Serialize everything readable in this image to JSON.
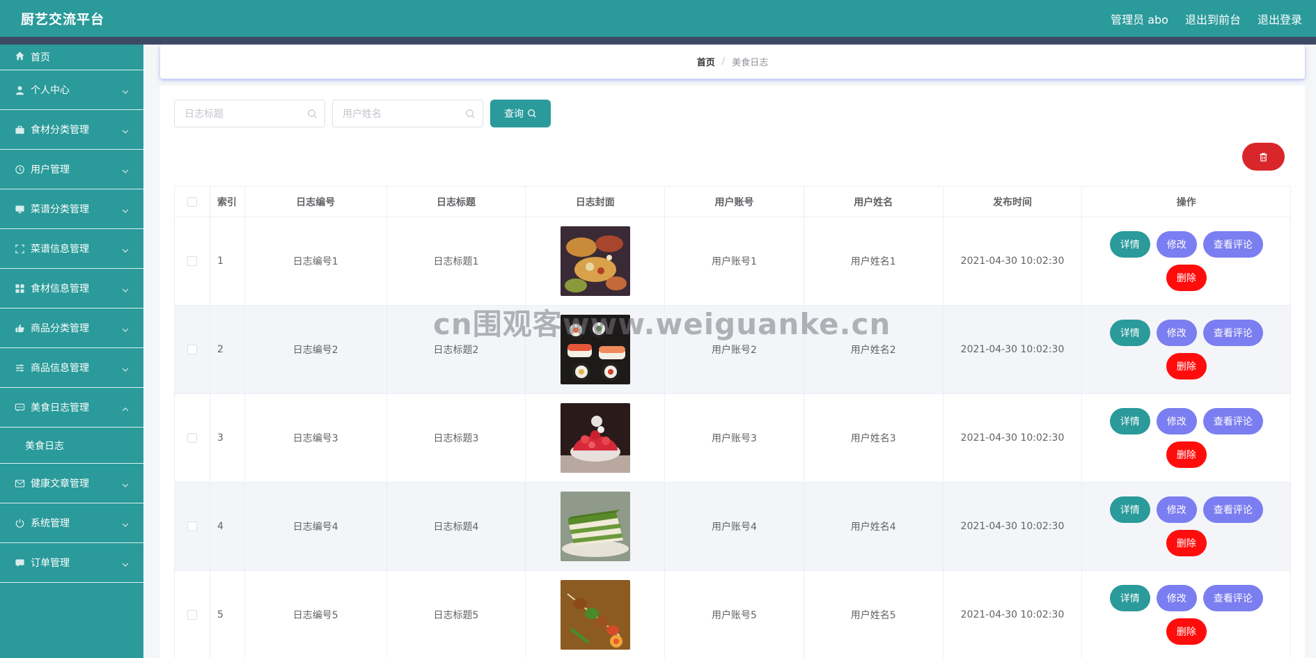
{
  "header": {
    "app_title": "厨艺交流平台",
    "admin_label": "管理员 abo",
    "to_frontend": "退出到前台",
    "logout": "退出登录"
  },
  "sidebar": {
    "items": [
      {
        "label": "首页",
        "icon": "home-icon"
      },
      {
        "label": "个人中心",
        "icon": "user-icon"
      },
      {
        "label": "食材分类管理",
        "icon": "briefcase-icon"
      },
      {
        "label": "用户管理",
        "icon": "clock-icon"
      },
      {
        "label": "菜谱分类管理",
        "icon": "monitor-icon"
      },
      {
        "label": "菜谱信息管理",
        "icon": "fullscreen-icon"
      },
      {
        "label": "食材信息管理",
        "icon": "grid-icon"
      },
      {
        "label": "商品分类管理",
        "icon": "thumb-icon"
      },
      {
        "label": "商品信息管理",
        "icon": "sliders-icon"
      },
      {
        "label": "美食日志管理",
        "icon": "chat-icon",
        "expanded": true
      },
      {
        "label": "健康文章管理",
        "icon": "mail-icon"
      },
      {
        "label": "系统管理",
        "icon": "power-icon"
      },
      {
        "label": "订单管理",
        "icon": "message-icon"
      }
    ],
    "submenu": {
      "label": "美食日志"
    }
  },
  "breadcrumb": {
    "home": "首页",
    "separator": "/",
    "current": "美食日志"
  },
  "search": {
    "title_placeholder": "日志标题",
    "name_placeholder": "用户姓名",
    "query_label": "查询"
  },
  "table": {
    "headers": {
      "index": "索引",
      "no": "日志编号",
      "title": "日志标题",
      "cover": "日志封面",
      "account": "用户账号",
      "name": "用户姓名",
      "time": "发布时间",
      "ops": "操作"
    },
    "rows": [
      {
        "index": "1",
        "no": "日志编号1",
        "title": "日志标题1",
        "account": "用户账号1",
        "name": "用户姓名1",
        "time": "2021-04-30 10:02:30",
        "cover": "buffet-food-image"
      },
      {
        "index": "2",
        "no": "日志编号2",
        "title": "日志标题2",
        "account": "用户账号2",
        "name": "用户姓名2",
        "time": "2021-04-30 10:02:30",
        "cover": "sushi-image"
      },
      {
        "index": "3",
        "no": "日志编号3",
        "title": "日志标题3",
        "account": "用户账号3",
        "name": "用户姓名3",
        "time": "2021-04-30 10:02:30",
        "cover": "strawberry-dessert-image"
      },
      {
        "index": "4",
        "no": "日志编号4",
        "title": "日志标题4",
        "account": "用户账号4",
        "name": "用户姓名4",
        "time": "2021-04-30 10:02:30",
        "cover": "matcha-cake-image"
      },
      {
        "index": "5",
        "no": "日志编号5",
        "title": "日志标题5",
        "account": "用户账号5",
        "name": "用户姓名5",
        "time": "2021-04-30 10:02:30",
        "cover": "skewer-image"
      }
    ],
    "ops": {
      "detail": "详情",
      "edit": "修改",
      "comments": "查看评论",
      "delete": "删除"
    }
  },
  "watermark": "cn围观客www.weiguanke.cn",
  "colors": {
    "primary": "#2a9a9a",
    "header_sub": "#3d4a63",
    "edit": "#7b7ef0",
    "delete": "#ff0d0d",
    "batch_delete": "#d9262b"
  }
}
